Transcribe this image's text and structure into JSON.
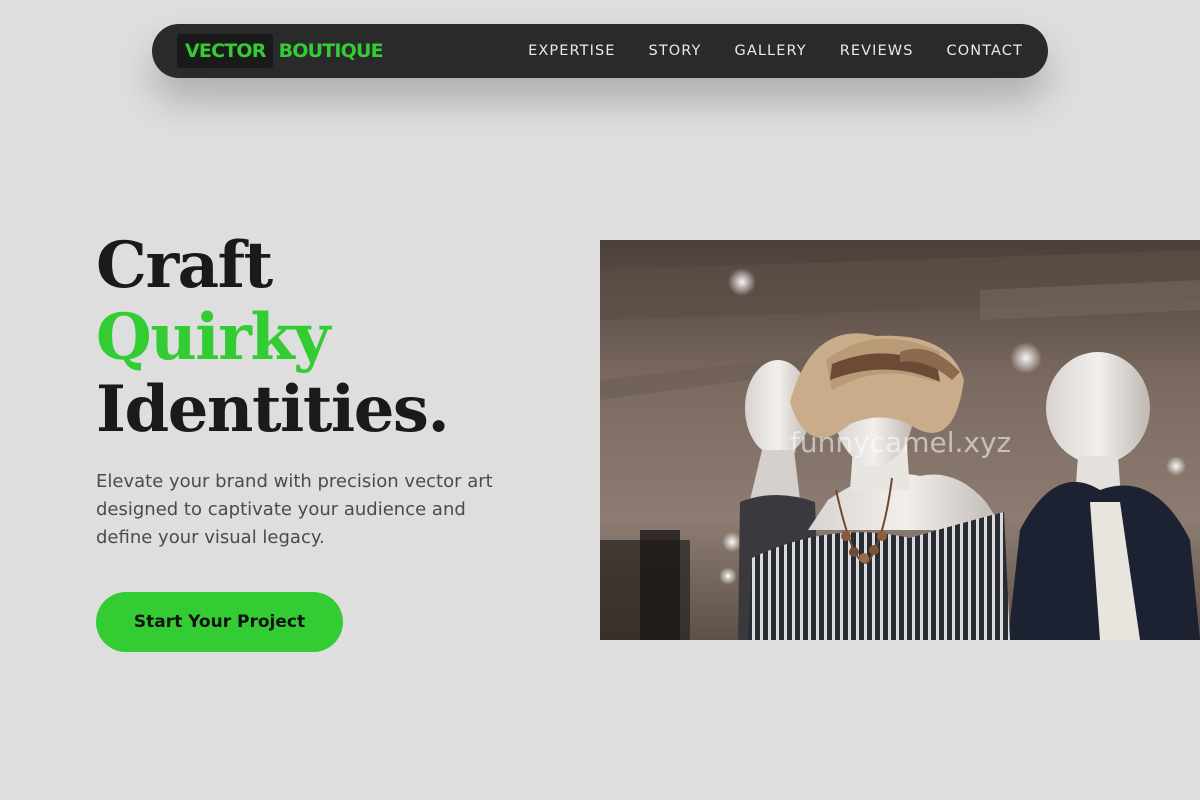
{
  "brand": {
    "part1": "VECTOR",
    "part2": "BOUTIQUE",
    "accent": "#33cc33"
  },
  "nav": {
    "items": [
      {
        "label": "EXPERTISE"
      },
      {
        "label": "STORY"
      },
      {
        "label": "GALLERY"
      },
      {
        "label": "REVIEWS"
      },
      {
        "label": "CONTACT"
      }
    ]
  },
  "hero": {
    "line1": "Craft",
    "line2": "Quirky",
    "line3": "Identities.",
    "description": "Elevate your brand with precision vector art designed to captivate your audience and define your visual legacy.",
    "cta": "Start Your Project"
  },
  "photo": {
    "watermark": "funnycamel.xyz"
  }
}
